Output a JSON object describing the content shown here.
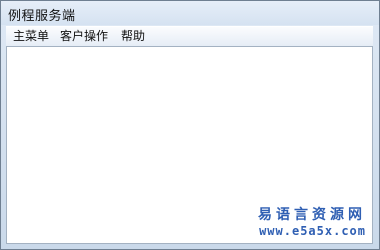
{
  "window": {
    "title": "例程服务端"
  },
  "menubar": {
    "items": [
      {
        "label": "主菜单"
      },
      {
        "label": "客户操作"
      },
      {
        "label": "帮助"
      }
    ]
  },
  "watermark": {
    "title": "易语言资源网",
    "url": "www.e5a5x.com"
  },
  "colors": {
    "watermark": "#2f5fb3",
    "client_background": "#ffffff",
    "frame": "#cad9ea"
  }
}
